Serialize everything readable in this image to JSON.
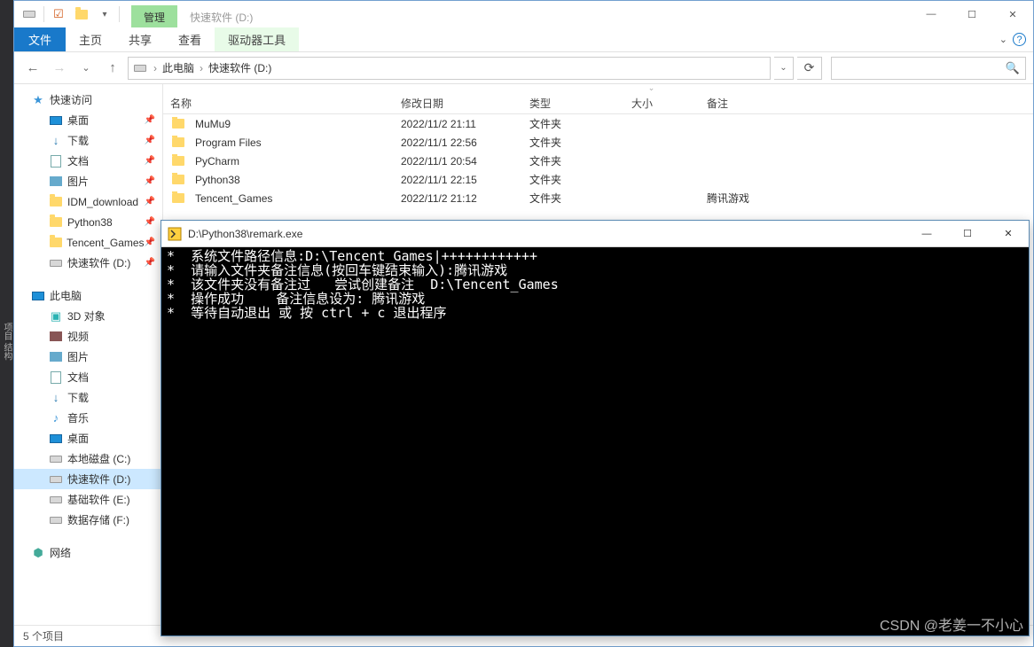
{
  "vs_label": "项目   结构",
  "titlebar": {
    "manage_tab": "管理",
    "title_text": "快速软件 (D:)"
  },
  "window_controls": {
    "min": "―",
    "max": "☐",
    "close": "✕"
  },
  "ribbon": {
    "file": "文件",
    "tabs": [
      "主页",
      "共享",
      "查看"
    ],
    "tool_tab": "驱动器工具",
    "help_icon": "?"
  },
  "nav": {
    "back": "←",
    "forward": "→",
    "recent": "⌄",
    "up": "↑",
    "breadcrumbs": [
      "此电脑",
      "快速软件 (D:)"
    ],
    "dropdown": "⌄",
    "refresh": "⟳",
    "search_icon": "🔍"
  },
  "sidebar": {
    "quick_access": "快速访问",
    "quick_items": [
      {
        "label": "桌面",
        "icon": "monitor"
      },
      {
        "label": "下载",
        "icon": "down"
      },
      {
        "label": "文档",
        "icon": "doc"
      },
      {
        "label": "图片",
        "icon": "pic"
      },
      {
        "label": "IDM_download",
        "icon": "folder"
      },
      {
        "label": "Python38",
        "icon": "folder"
      },
      {
        "label": "Tencent_Games",
        "icon": "folder"
      },
      {
        "label": "快速软件 (D:)",
        "icon": "drive"
      }
    ],
    "this_pc": "此电脑",
    "pc_items": [
      {
        "label": "3D 对象",
        "icon": "3d"
      },
      {
        "label": "视频",
        "icon": "video"
      },
      {
        "label": "图片",
        "icon": "pic"
      },
      {
        "label": "文档",
        "icon": "doc"
      },
      {
        "label": "下载",
        "icon": "down"
      },
      {
        "label": "音乐",
        "icon": "music"
      },
      {
        "label": "桌面",
        "icon": "monitor"
      },
      {
        "label": "本地磁盘 (C:)",
        "icon": "drive"
      },
      {
        "label": "快速软件 (D:)",
        "icon": "drive",
        "selected": true
      },
      {
        "label": "基础软件 (E:)",
        "icon": "drive"
      },
      {
        "label": "数据存储 (F:)",
        "icon": "drive"
      }
    ],
    "network": "网络"
  },
  "columns": {
    "name": "名称",
    "date": "修改日期",
    "type": "类型",
    "size": "大小",
    "remark": "备注"
  },
  "rows": [
    {
      "name": "MuMu9",
      "date": "2022/11/2 21:11",
      "type": "文件夹",
      "size": "",
      "remark": ""
    },
    {
      "name": "Program Files",
      "date": "2022/11/1 22:56",
      "type": "文件夹",
      "size": "",
      "remark": ""
    },
    {
      "name": "PyCharm",
      "date": "2022/11/1 20:54",
      "type": "文件夹",
      "size": "",
      "remark": ""
    },
    {
      "name": "Python38",
      "date": "2022/11/1 22:15",
      "type": "文件夹",
      "size": "",
      "remark": ""
    },
    {
      "name": "Tencent_Games",
      "date": "2022/11/2 21:12",
      "type": "文件夹",
      "size": "",
      "remark": "腾讯游戏"
    }
  ],
  "status_bar": "5 个项目",
  "console": {
    "title": "D:\\Python38\\remark.exe",
    "lines": [
      "*  系统文件路径信息:D:\\Tencent_Games|++++++++++++",
      "*  请输入文件夹备注信息(按回车键结束输入):腾讯游戏",
      "*  该文件夹没有备注过   尝试创建备注  D:\\Tencent_Games",
      "*  操作成功    备注信息设为: 腾讯游戏",
      "*  等待自动退出 或 按 ctrl + c 退出程序"
    ]
  },
  "watermark": "CSDN @老姜一不小心"
}
